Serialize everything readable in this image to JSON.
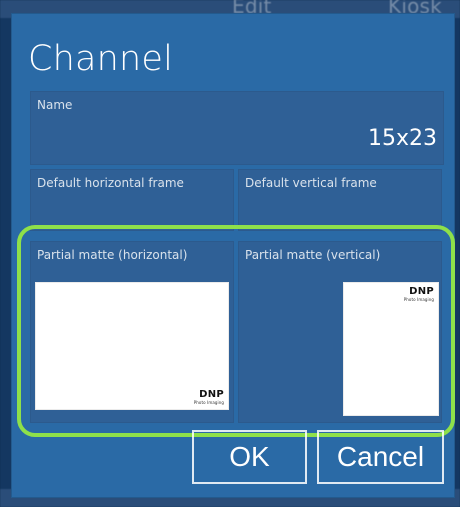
{
  "background": {
    "top_left_text": "Edit",
    "top_right_text": "Kiosk"
  },
  "dialog": {
    "title": "Channel",
    "name": {
      "label": "Name",
      "value": "15x23"
    },
    "default_horizontal_frame": {
      "label": "Default horizontal frame"
    },
    "default_vertical_frame": {
      "label": "Default vertical frame"
    },
    "partial_matte_horizontal": {
      "label": "Partial matte (horizontal)",
      "brand": "DNP",
      "brand_subtext": "Photo Imaging"
    },
    "partial_matte_vertical": {
      "label": "Partial matte (vertical)",
      "brand": "DNP",
      "brand_subtext": "Photo Imaging"
    },
    "buttons": {
      "ok": "OK",
      "cancel": "Cancel"
    }
  },
  "colors": {
    "dialog_background": "#2a6aa6",
    "field_background": "#2f6096",
    "highlight": "#8ee04a",
    "text": "#ffffff"
  }
}
